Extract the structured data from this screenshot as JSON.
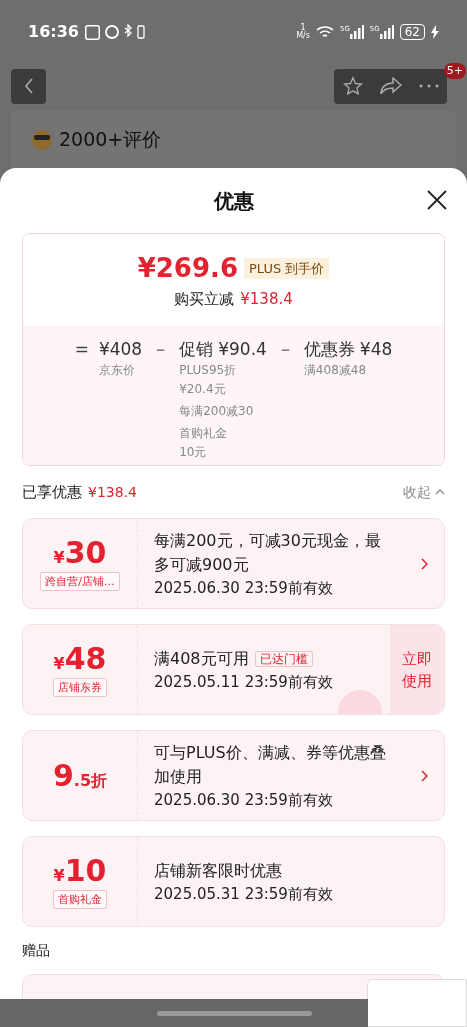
{
  "status_bar": {
    "time": "16:36",
    "speed_value": "1",
    "speed_unit": "M/s",
    "network_1": "5G",
    "network_2": "5G",
    "battery": "62"
  },
  "top_bar": {
    "badge": "5+"
  },
  "product": {
    "reviews": "2000+评价"
  },
  "sheet": {
    "title": "优惠",
    "summary": {
      "price": "¥269.6",
      "price_badge": "PLUS 到手价",
      "saving_label": "购买立减",
      "saving": "¥138.4",
      "breakdown": [
        {
          "operator": "=",
          "amount": "¥408",
          "notes": [
            "京东价"
          ]
        },
        {
          "operator": "－",
          "label": "促销",
          "amount": "¥90.4",
          "notes": [
            "PLUS95折\n¥20.4元",
            "每满200减30",
            "首购礼金\n10元"
          ]
        },
        {
          "operator": "－",
          "label": "优惠券",
          "amount": "¥48",
          "notes": [
            "满408减48"
          ]
        }
      ]
    },
    "enjoyed": {
      "label": "已享优惠",
      "amount": "¥138.4",
      "toggle": "收起"
    },
    "coupons": [
      {
        "prefix": "¥",
        "main": "30",
        "tag": "跨自营/店铺…",
        "description": "每满200元，可减30元现金，最多可减900元",
        "validity": "2025.06.30 23:59前有效",
        "action": {
          "kind": "chevron"
        }
      },
      {
        "prefix": "¥",
        "main": "48",
        "tag": "店铺东券",
        "description": "满408元可用",
        "badge": "已达门槛",
        "validity": "2025.05.11 23:59前有效",
        "action": {
          "kind": "button",
          "label": "立即使用"
        },
        "stamped": true
      },
      {
        "main": "9",
        "suffix": ".5折",
        "description": "可与PLUS价、满减、券等优惠叠加使用",
        "validity": "2025.06.30 23:59前有效",
        "action": {
          "kind": "chevron"
        }
      },
      {
        "prefix": "¥",
        "main": "10",
        "tag": "首购礼金",
        "description": "店铺新客限时优惠",
        "validity": "2025.05.31 23:59前有效"
      }
    ],
    "gifts": {
      "title": "赠品"
    }
  }
}
